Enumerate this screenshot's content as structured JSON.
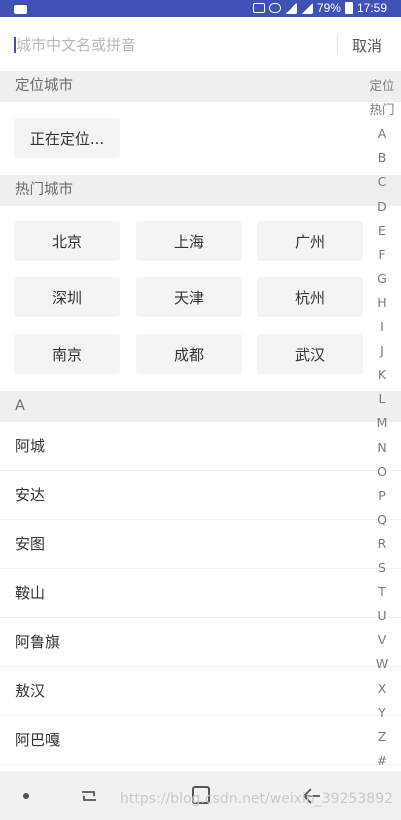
{
  "status_bar": {
    "battery": "79%",
    "time": "17:59"
  },
  "search": {
    "placeholder": "城市中文名或拼音",
    "cancel_label": "取消"
  },
  "location": {
    "header": "定位城市",
    "current": "正在定位..."
  },
  "hot": {
    "header": "热门城市",
    "cities": [
      "北京",
      "上海",
      "广州",
      "深圳",
      "天津",
      "杭州",
      "南京",
      "成都",
      "武汉"
    ]
  },
  "section_a": {
    "header": "A",
    "cities": [
      "阿城",
      "安达",
      "安图",
      "鞍山",
      "阿鲁旗",
      "敖汉",
      "阿巴嘎"
    ]
  },
  "index": [
    "定位",
    "热门",
    "A",
    "B",
    "C",
    "D",
    "E",
    "F",
    "G",
    "H",
    "I",
    "J",
    "K",
    "L",
    "M",
    "N",
    "O",
    "P",
    "Q",
    "R",
    "S",
    "T",
    "U",
    "V",
    "W",
    "X",
    "Y",
    "Z",
    "#"
  ],
  "watermark": "https://blog.csdn.net/weixin_39253892",
  "colors": {
    "status_bar": "#3f51b5",
    "section_bg": "#efefef",
    "chip_bg": "#f4f4f4"
  }
}
